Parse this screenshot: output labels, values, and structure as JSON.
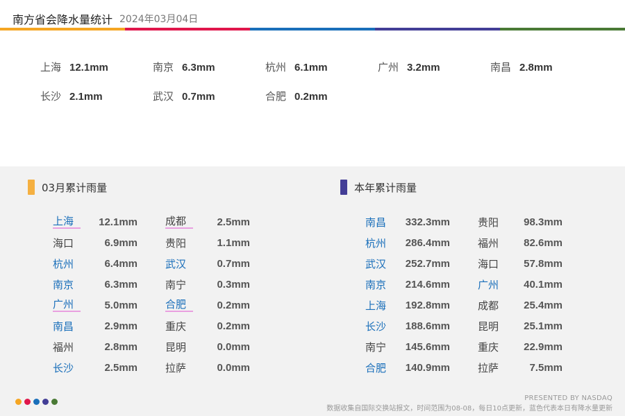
{
  "header": {
    "title": "南方省会降水量统计",
    "date": "2024年03月04日"
  },
  "colors": {
    "bar": [
      "#f5a623",
      "#e0174b",
      "#1a6fba",
      "#433e96",
      "#4a7a35"
    ],
    "march_marker": "#f5b041",
    "year_marker": "#433e96",
    "highlight_city": "#1a6fba"
  },
  "today": [
    {
      "city": "上海",
      "value": "12.1mm"
    },
    {
      "city": "南京",
      "value": "6.3mm"
    },
    {
      "city": "杭州",
      "value": "6.1mm"
    },
    {
      "city": "广州",
      "value": "3.2mm"
    },
    {
      "city": "南昌",
      "value": "2.8mm"
    },
    {
      "city": "长沙",
      "value": "2.1mm"
    },
    {
      "city": "武汉",
      "value": "0.7mm"
    },
    {
      "city": "合肥",
      "value": "0.2mm"
    }
  ],
  "march": {
    "label": "03月累计雨量",
    "left": [
      {
        "city": "上海",
        "value": "12.1mm",
        "hl": true
      },
      {
        "city": "海口",
        "value": "6.9mm",
        "hl": false
      },
      {
        "city": "杭州",
        "value": "6.4mm",
        "hl": true
      },
      {
        "city": "南京",
        "value": "6.3mm",
        "hl": true
      },
      {
        "city": "广州",
        "value": "5.0mm",
        "hl": true
      },
      {
        "city": "南昌",
        "value": "2.9mm",
        "hl": true
      },
      {
        "city": "福州",
        "value": "2.8mm",
        "hl": false
      },
      {
        "city": "长沙",
        "value": "2.5mm",
        "hl": true
      }
    ],
    "right": [
      {
        "city": "成都",
        "value": "2.5mm",
        "hl": false
      },
      {
        "city": "贵阳",
        "value": "1.1mm",
        "hl": false
      },
      {
        "city": "武汉",
        "value": "0.7mm",
        "hl": true
      },
      {
        "city": "南宁",
        "value": "0.3mm",
        "hl": false
      },
      {
        "city": "合肥",
        "value": "0.2mm",
        "hl": true
      },
      {
        "city": "重庆",
        "value": "0.2mm",
        "hl": false
      },
      {
        "city": "昆明",
        "value": "0.0mm",
        "hl": false
      },
      {
        "city": "拉萨",
        "value": "0.0mm",
        "hl": false
      }
    ]
  },
  "year": {
    "label": "本年累计雨量",
    "left": [
      {
        "city": "南昌",
        "value": "332.3mm",
        "hl": true
      },
      {
        "city": "杭州",
        "value": "286.4mm",
        "hl": true
      },
      {
        "city": "武汉",
        "value": "252.7mm",
        "hl": true
      },
      {
        "city": "南京",
        "value": "214.6mm",
        "hl": true
      },
      {
        "city": "上海",
        "value": "192.8mm",
        "hl": true
      },
      {
        "city": "长沙",
        "value": "188.6mm",
        "hl": true
      },
      {
        "city": "南宁",
        "value": "145.6mm",
        "hl": false
      },
      {
        "city": "合肥",
        "value": "140.9mm",
        "hl": true
      }
    ],
    "right": [
      {
        "city": "贵阳",
        "value": "98.3mm",
        "hl": false
      },
      {
        "city": "福州",
        "value": "82.6mm",
        "hl": false
      },
      {
        "city": "海口",
        "value": "57.8mm",
        "hl": false
      },
      {
        "city": "广州",
        "value": "40.1mm",
        "hl": true
      },
      {
        "city": "成都",
        "value": "25.4mm",
        "hl": false
      },
      {
        "city": "昆明",
        "value": "25.1mm",
        "hl": false
      },
      {
        "city": "重庆",
        "value": "22.9mm",
        "hl": false
      },
      {
        "city": "拉萨",
        "value": "7.5mm",
        "hl": false
      }
    ]
  },
  "footer": {
    "presented": "PRESENTED BY NASDAQ",
    "note": "数据收集自国际交换站报文，时间范围为08-08，每日10点更新，蓝色代表本日有降水量更新"
  }
}
